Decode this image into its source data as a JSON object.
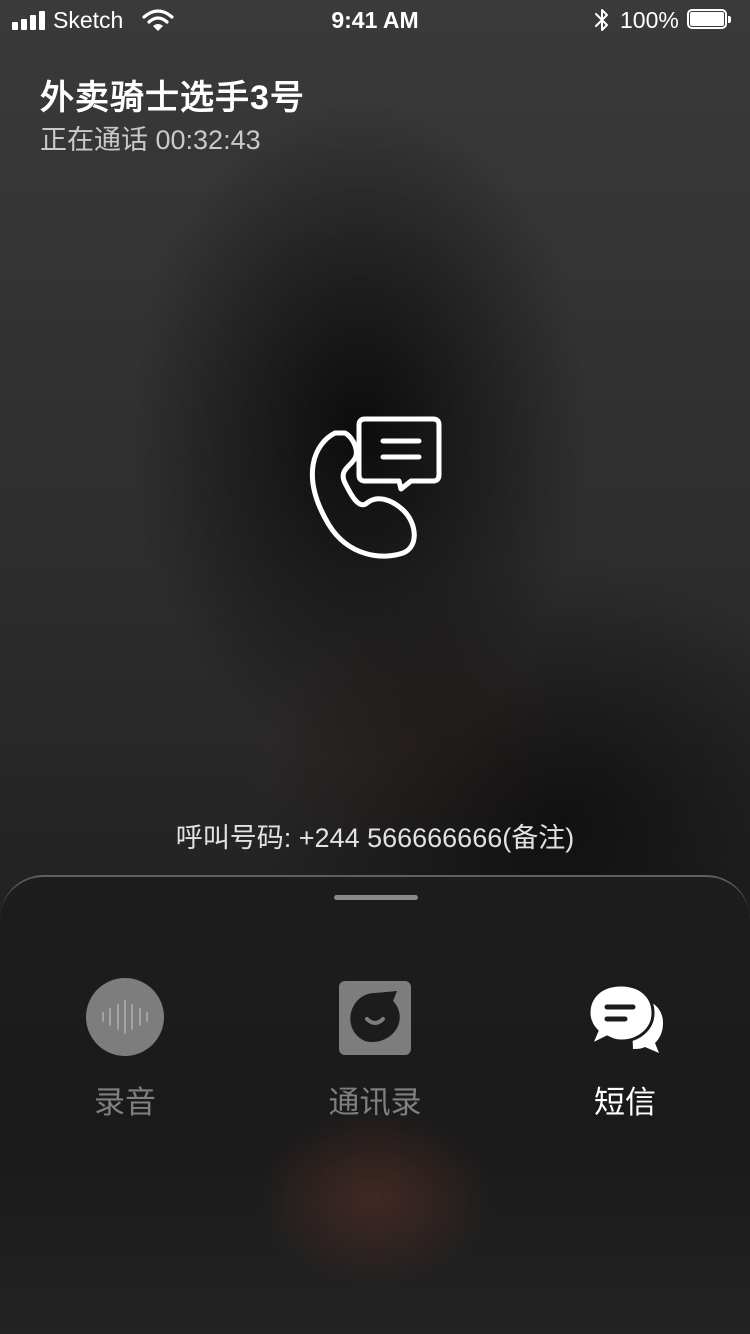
{
  "status_bar": {
    "carrier": "Sketch",
    "time": "9:41 AM",
    "battery": "100%"
  },
  "call": {
    "name": "外卖骑士选手3号",
    "status": "正在通话 00:32:43",
    "dial_number": "呼叫号码: +244 566666666(备注)"
  },
  "actions": [
    {
      "label": "录音",
      "icon": "voice-record-icon",
      "active": false
    },
    {
      "label": "通讯录",
      "icon": "contacts-icon",
      "active": false
    },
    {
      "label": "短信",
      "icon": "sms-icon",
      "active": true
    }
  ],
  "colors": {
    "active_label": "#ffffff",
    "inactive_label": "#7f7f7f",
    "inactive_icon": "#7d7d7d"
  }
}
